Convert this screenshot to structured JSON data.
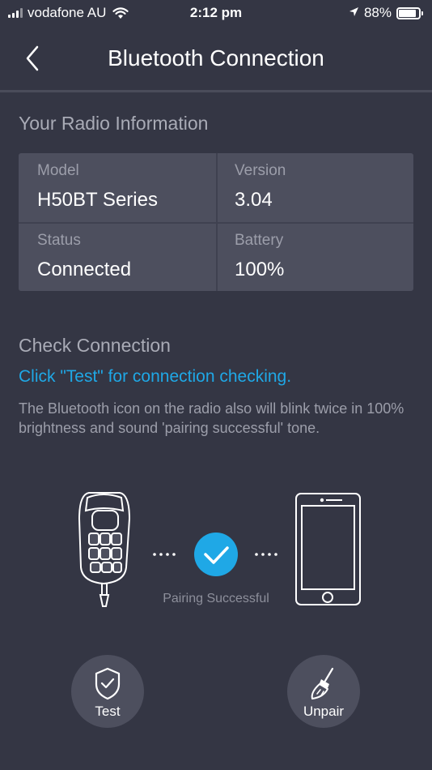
{
  "status_bar": {
    "carrier": "vodafone AU",
    "time": "2:12 pm",
    "battery": "88%"
  },
  "nav": {
    "title": "Bluetooth Connection"
  },
  "radio_info": {
    "heading": "Your Radio Information",
    "model_label": "Model",
    "model_value": "H50BT Series",
    "version_label": "Version",
    "version_value": "3.04",
    "status_label": "Status",
    "status_value": "Connected",
    "battery_label": "Battery",
    "battery_value": "100%"
  },
  "check": {
    "heading": "Check Connection",
    "link": "Click \"Test\" for connection checking.",
    "description": "The Bluetooth icon on the radio also will blink twice in 100% brightness and sound 'pairing successful' tone.",
    "pairing_status": "Pairing Successful"
  },
  "actions": {
    "test_label": "Test",
    "unpair_label": "Unpair"
  },
  "colors": {
    "background": "#343644",
    "card": "#4d4f5e",
    "accent": "#1fa8e6"
  },
  "icons": [
    "back-icon",
    "wifi-icon",
    "location-icon",
    "battery-icon",
    "radio-mic-icon",
    "check-icon",
    "phone-icon",
    "shield-check-icon",
    "broom-icon"
  ]
}
